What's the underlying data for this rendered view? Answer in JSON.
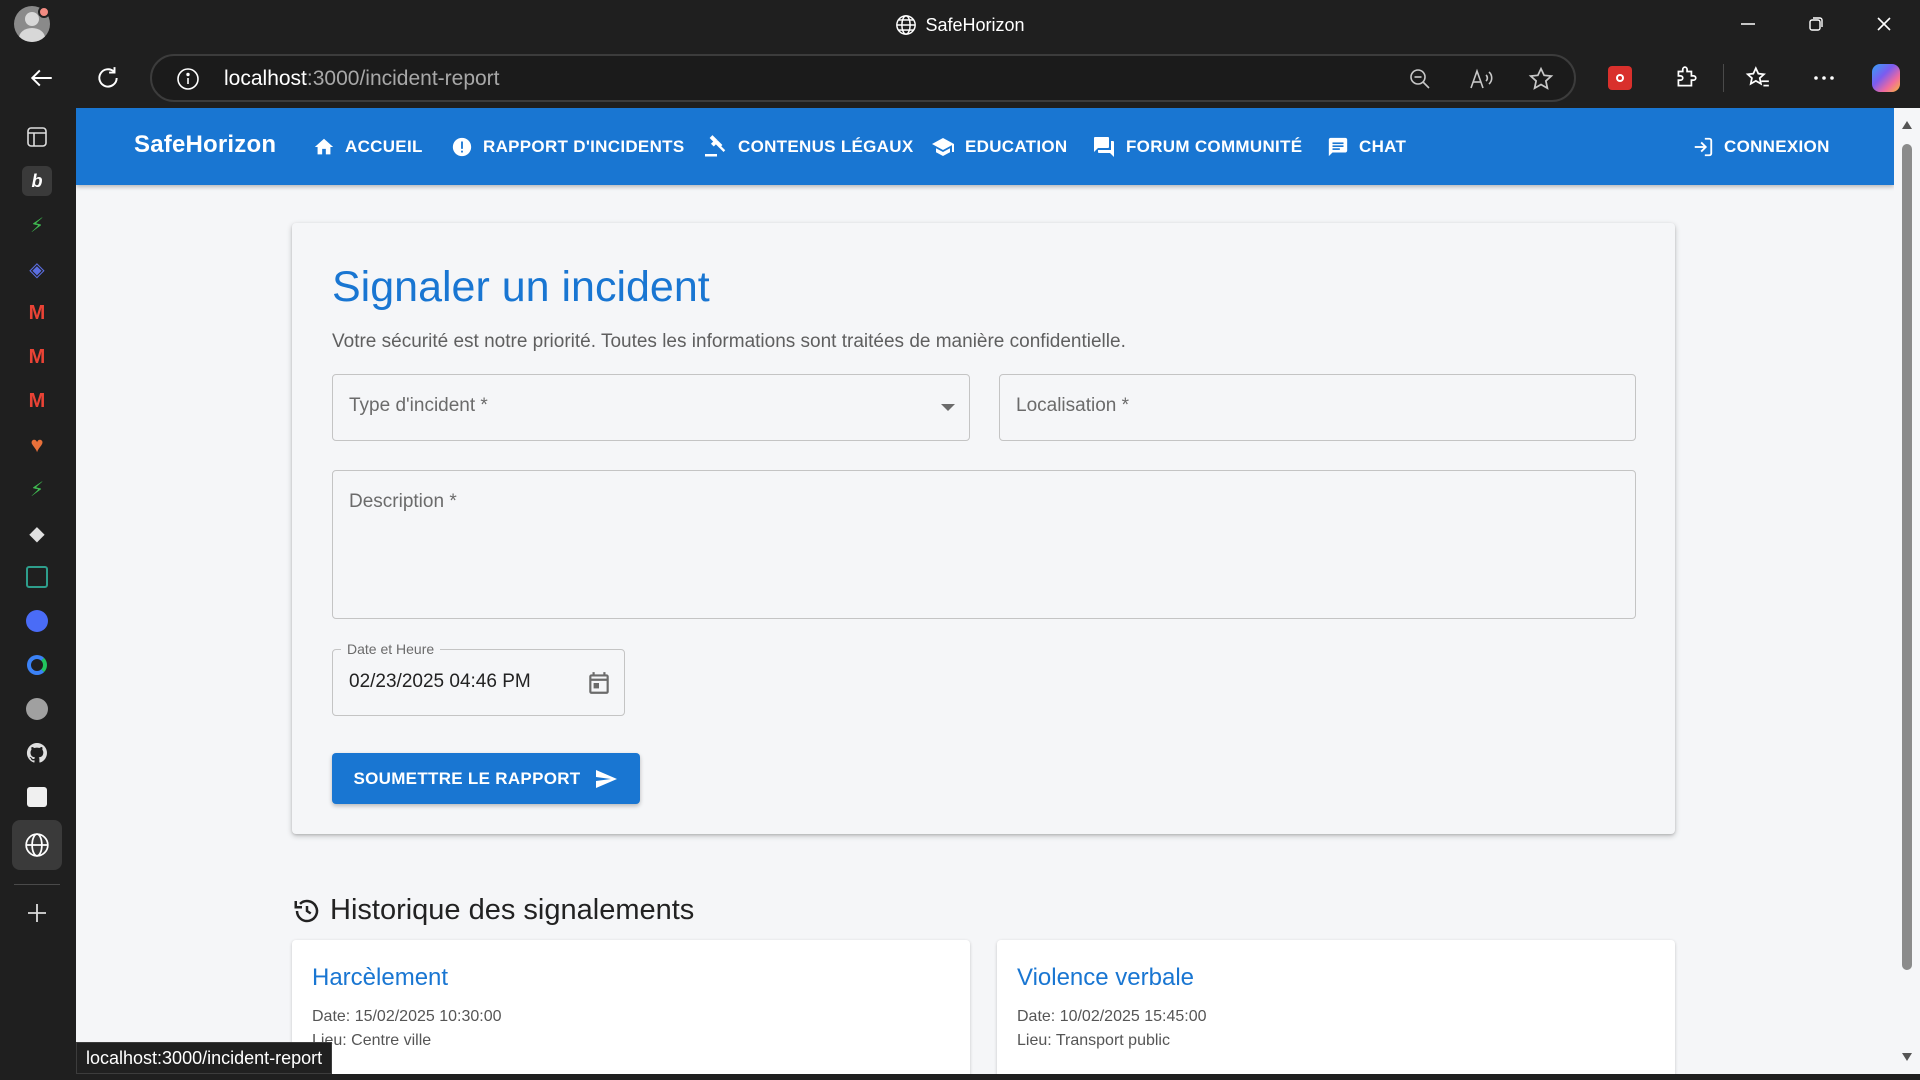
{
  "window": {
    "title": "SafeHorizon"
  },
  "browser": {
    "url_host": "localhost",
    "url_path": ":3000/incident-report",
    "status_url": "localhost:3000/incident-report"
  },
  "app": {
    "brand": "SafeHorizon",
    "nav": [
      {
        "label": "Accueil",
        "icon": "home-icon"
      },
      {
        "label": "Rapport d'incidents",
        "icon": "alert-icon"
      },
      {
        "label": "Contenus légaux",
        "icon": "gavel-icon"
      },
      {
        "label": "Education",
        "icon": "school-icon"
      },
      {
        "label": "Forum Communité",
        "icon": "forum-icon"
      },
      {
        "label": "Chat",
        "icon": "chat-icon"
      }
    ],
    "login_label": "Connexion"
  },
  "form": {
    "title": "Signaler un incident",
    "subtitle": "Votre sécurité est notre priorité. Toutes les informations sont traitées de manière confidentielle.",
    "type_label": "Type d'incident *",
    "location_label": "Localisation *",
    "description_label": "Description *",
    "date_label": "Date et Heure",
    "date_value": "02/23/2025 04:46 PM",
    "submit_label": "SOUMETTRE LE RAPPORT"
  },
  "history": {
    "title": "Historique des signalements",
    "items": [
      {
        "title": "Harcèlement",
        "date": "Date: 15/02/2025 10:30:00",
        "location": "Lieu: Centre ville"
      },
      {
        "title": "Violence verbale",
        "date": "Date: 10/02/2025 15:45:00",
        "location": "Lieu: Transport public"
      }
    ]
  },
  "colors": {
    "primary": "#1976d2",
    "background": "#f5f6f8",
    "chrome": "#1f1f1f"
  }
}
